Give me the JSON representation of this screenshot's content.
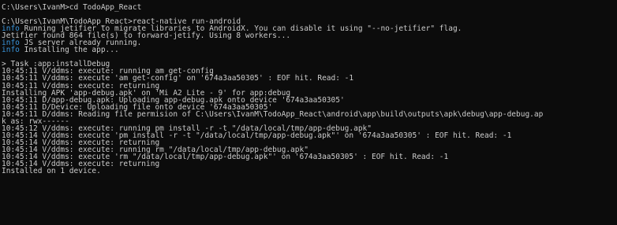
{
  "terminal": {
    "theme": {
      "background": "#0c0c0c",
      "foreground": "#cccccc",
      "info_color": "#3a96dd"
    },
    "lines": [
      {
        "segments": [
          {
            "t": "C:\\Users\\IvanM>cd TodoApp_React"
          }
        ]
      },
      {
        "blank": true
      },
      {
        "segments": [
          {
            "t": "C:\\Users\\IvanM\\TodoApp_React>react-native run-android"
          }
        ]
      },
      {
        "segments": [
          {
            "k": "info",
            "t": "info"
          },
          {
            "t": " Running jetifier to migrate libraries to AndroidX. You can disable it using \"--no-jetifier\" flag."
          }
        ]
      },
      {
        "segments": [
          {
            "t": "Jetifier found 864 file(s) to forward-jetify. Using 8 workers..."
          }
        ]
      },
      {
        "segments": [
          {
            "k": "info",
            "t": "info"
          },
          {
            "t": " JS server already running."
          }
        ]
      },
      {
        "segments": [
          {
            "k": "info",
            "t": "info"
          },
          {
            "t": " Installing the app..."
          }
        ]
      },
      {
        "blank": true
      },
      {
        "segments": [
          {
            "t": "> Task :app:installDebug"
          }
        ]
      },
      {
        "segments": [
          {
            "t": "10:45:11 V/ddms: execute: running am get-config"
          }
        ]
      },
      {
        "segments": [
          {
            "t": "10:45:11 V/ddms: execute 'am get-config' on '674a3aa50305' : EOF hit. Read: -1"
          }
        ]
      },
      {
        "segments": [
          {
            "t": "10:45:11 V/ddms: execute: returning"
          }
        ]
      },
      {
        "segments": [
          {
            "t": "Installing APK 'app-debug.apk' on 'Mi A2 Lite - 9' for app:debug"
          }
        ]
      },
      {
        "segments": [
          {
            "t": "10:45:11 D/app-debug.apk: Uploading app-debug.apk onto device '674a3aa50305'"
          }
        ]
      },
      {
        "segments": [
          {
            "t": "10:45:11 D/Device: Uploading file onto device '674a3aa50305'"
          }
        ]
      },
      {
        "segments": [
          {
            "t": "10:45:11 D/ddms: Reading file permision of C:\\Users\\IvanM\\TodoApp_React\\android\\app\\build\\outputs\\apk\\debug\\app-debug.ap"
          }
        ]
      },
      {
        "segments": [
          {
            "t": "k as: rwx------"
          }
        ]
      },
      {
        "segments": [
          {
            "t": "10:45:12 V/ddms: execute: running pm install -r -t \"/data/local/tmp/app-debug.apk\""
          }
        ]
      },
      {
        "segments": [
          {
            "t": "10:45:14 V/ddms: execute 'pm install -r -t \"/data/local/tmp/app-debug.apk\"' on '674a3aa50305' : EOF hit. Read: -1"
          }
        ]
      },
      {
        "segments": [
          {
            "t": "10:45:14 V/ddms: execute: returning"
          }
        ]
      },
      {
        "segments": [
          {
            "t": "10:45:14 V/ddms: execute: running rm \"/data/local/tmp/app-debug.apk\""
          }
        ]
      },
      {
        "segments": [
          {
            "t": "10:45:14 V/ddms: execute 'rm \"/data/local/tmp/app-debug.apk\"' on '674a3aa50305' : EOF hit. Read: -1"
          }
        ]
      },
      {
        "segments": [
          {
            "t": "10:45:14 V/ddms: execute: returning"
          }
        ]
      },
      {
        "segments": [
          {
            "t": "Installed on 1 device."
          }
        ]
      }
    ]
  }
}
